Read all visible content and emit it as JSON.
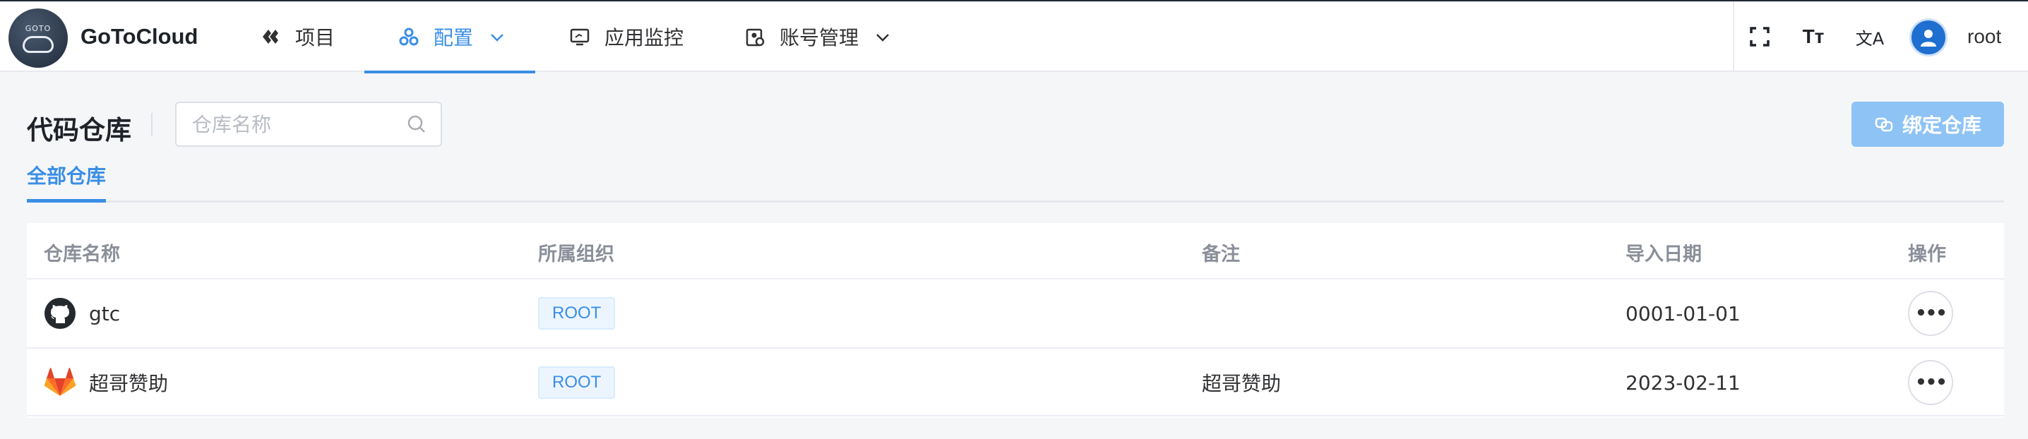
{
  "app": {
    "brand": "GoToCloud",
    "logo_text": "GOTO"
  },
  "nav": {
    "items": [
      {
        "label": "项目",
        "icon": "project-icon"
      },
      {
        "label": "配置",
        "icon": "config-icon",
        "active": true,
        "has_dropdown": true
      },
      {
        "label": "应用监控",
        "icon": "monitor-icon"
      },
      {
        "label": "账号管理",
        "icon": "account-icon",
        "has_dropdown": true
      }
    ]
  },
  "header_tools": {
    "fullscreen_icon": "fullscreen-icon",
    "font_size_glyph": "Tт",
    "translate_glyph": "文A",
    "username": "root"
  },
  "page": {
    "title": "代码仓库",
    "search_placeholder": "仓库名称",
    "bind_button_label": "绑定仓库"
  },
  "tabs": [
    {
      "label": "全部仓库",
      "active": true
    }
  ],
  "table": {
    "columns": [
      "仓库名称",
      "所属组织",
      "备注",
      "导入日期",
      "操作"
    ],
    "rows": [
      {
        "name": "gtc",
        "provider": "github",
        "org": "ROOT",
        "note": "",
        "date": "0001-01-01",
        "action": "•••"
      },
      {
        "name": "超哥赞助",
        "provider": "gitlab",
        "org": "ROOT",
        "note": "超哥赞助",
        "date": "2023-02-11",
        "action": "•••"
      }
    ]
  },
  "colors": {
    "accent": "#3a8ee6",
    "button_bg": "#8ec3f5",
    "tag_bg": "#ecf5ff"
  }
}
